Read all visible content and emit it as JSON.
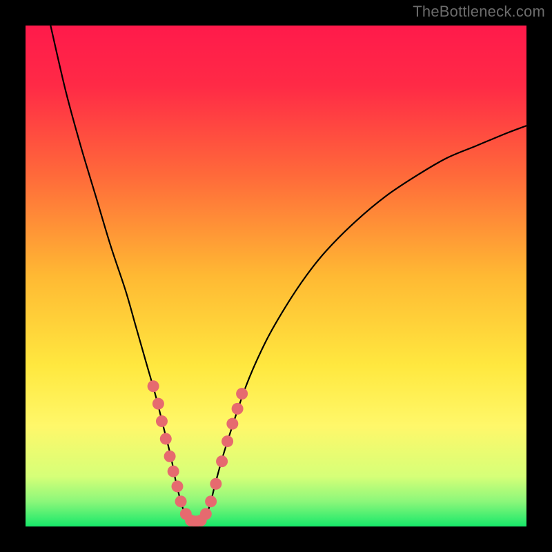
{
  "attribution": "TheBottleneck.com",
  "colors": {
    "frame": "#000000",
    "gradient_stops": [
      {
        "offset": 0.0,
        "color": "#ff1a4b"
      },
      {
        "offset": 0.12,
        "color": "#ff2a46"
      },
      {
        "offset": 0.3,
        "color": "#ff6a3a"
      },
      {
        "offset": 0.5,
        "color": "#ffb933"
      },
      {
        "offset": 0.68,
        "color": "#ffe83f"
      },
      {
        "offset": 0.8,
        "color": "#fff86a"
      },
      {
        "offset": 0.9,
        "color": "#d6ff78"
      },
      {
        "offset": 0.95,
        "color": "#8cf77a"
      },
      {
        "offset": 1.0,
        "color": "#17e86a"
      }
    ],
    "curve": "#000000",
    "marker_fill": "#e66a6f",
    "marker_stroke": "#d15a60"
  },
  "chart_data": {
    "type": "line",
    "title": "",
    "xlabel": "",
    "ylabel": "",
    "xlim": [
      0,
      100
    ],
    "ylim": [
      0,
      100
    ],
    "series": [
      {
        "name": "bottleneck-curve",
        "x": [
          5,
          8,
          11,
          14,
          17,
          20,
          22,
          24,
          26,
          27.5,
          29,
          30,
          31,
          32,
          33,
          34,
          35,
          36,
          37,
          38,
          40,
          44,
          48,
          52,
          56,
          60,
          66,
          72,
          78,
          84,
          90,
          96,
          100
        ],
        "y": [
          100,
          87,
          76,
          66,
          56,
          47,
          40,
          33,
          26,
          20,
          14,
          9,
          5,
          2,
          0.5,
          0.3,
          0.5,
          2,
          5,
          9,
          16,
          28,
          37,
          44,
          50,
          55,
          61,
          66,
          70,
          73.5,
          76,
          78.5,
          80
        ]
      }
    ],
    "markers": {
      "name": "highlighted-points",
      "x": [
        25.5,
        26.5,
        27.2,
        28.0,
        28.8,
        29.5,
        30.3,
        31.0,
        32.0,
        33.0,
        34.0,
        35.0,
        36.0,
        37.0,
        38.0,
        39.2,
        40.3,
        41.3,
        42.3,
        43.2
      ],
      "y": [
        28.0,
        24.5,
        21.0,
        17.5,
        14.0,
        11.0,
        8.0,
        5.0,
        2.5,
        1.2,
        1.0,
        1.2,
        2.5,
        5.0,
        8.5,
        13.0,
        17.0,
        20.5,
        23.5,
        26.5
      ]
    }
  }
}
